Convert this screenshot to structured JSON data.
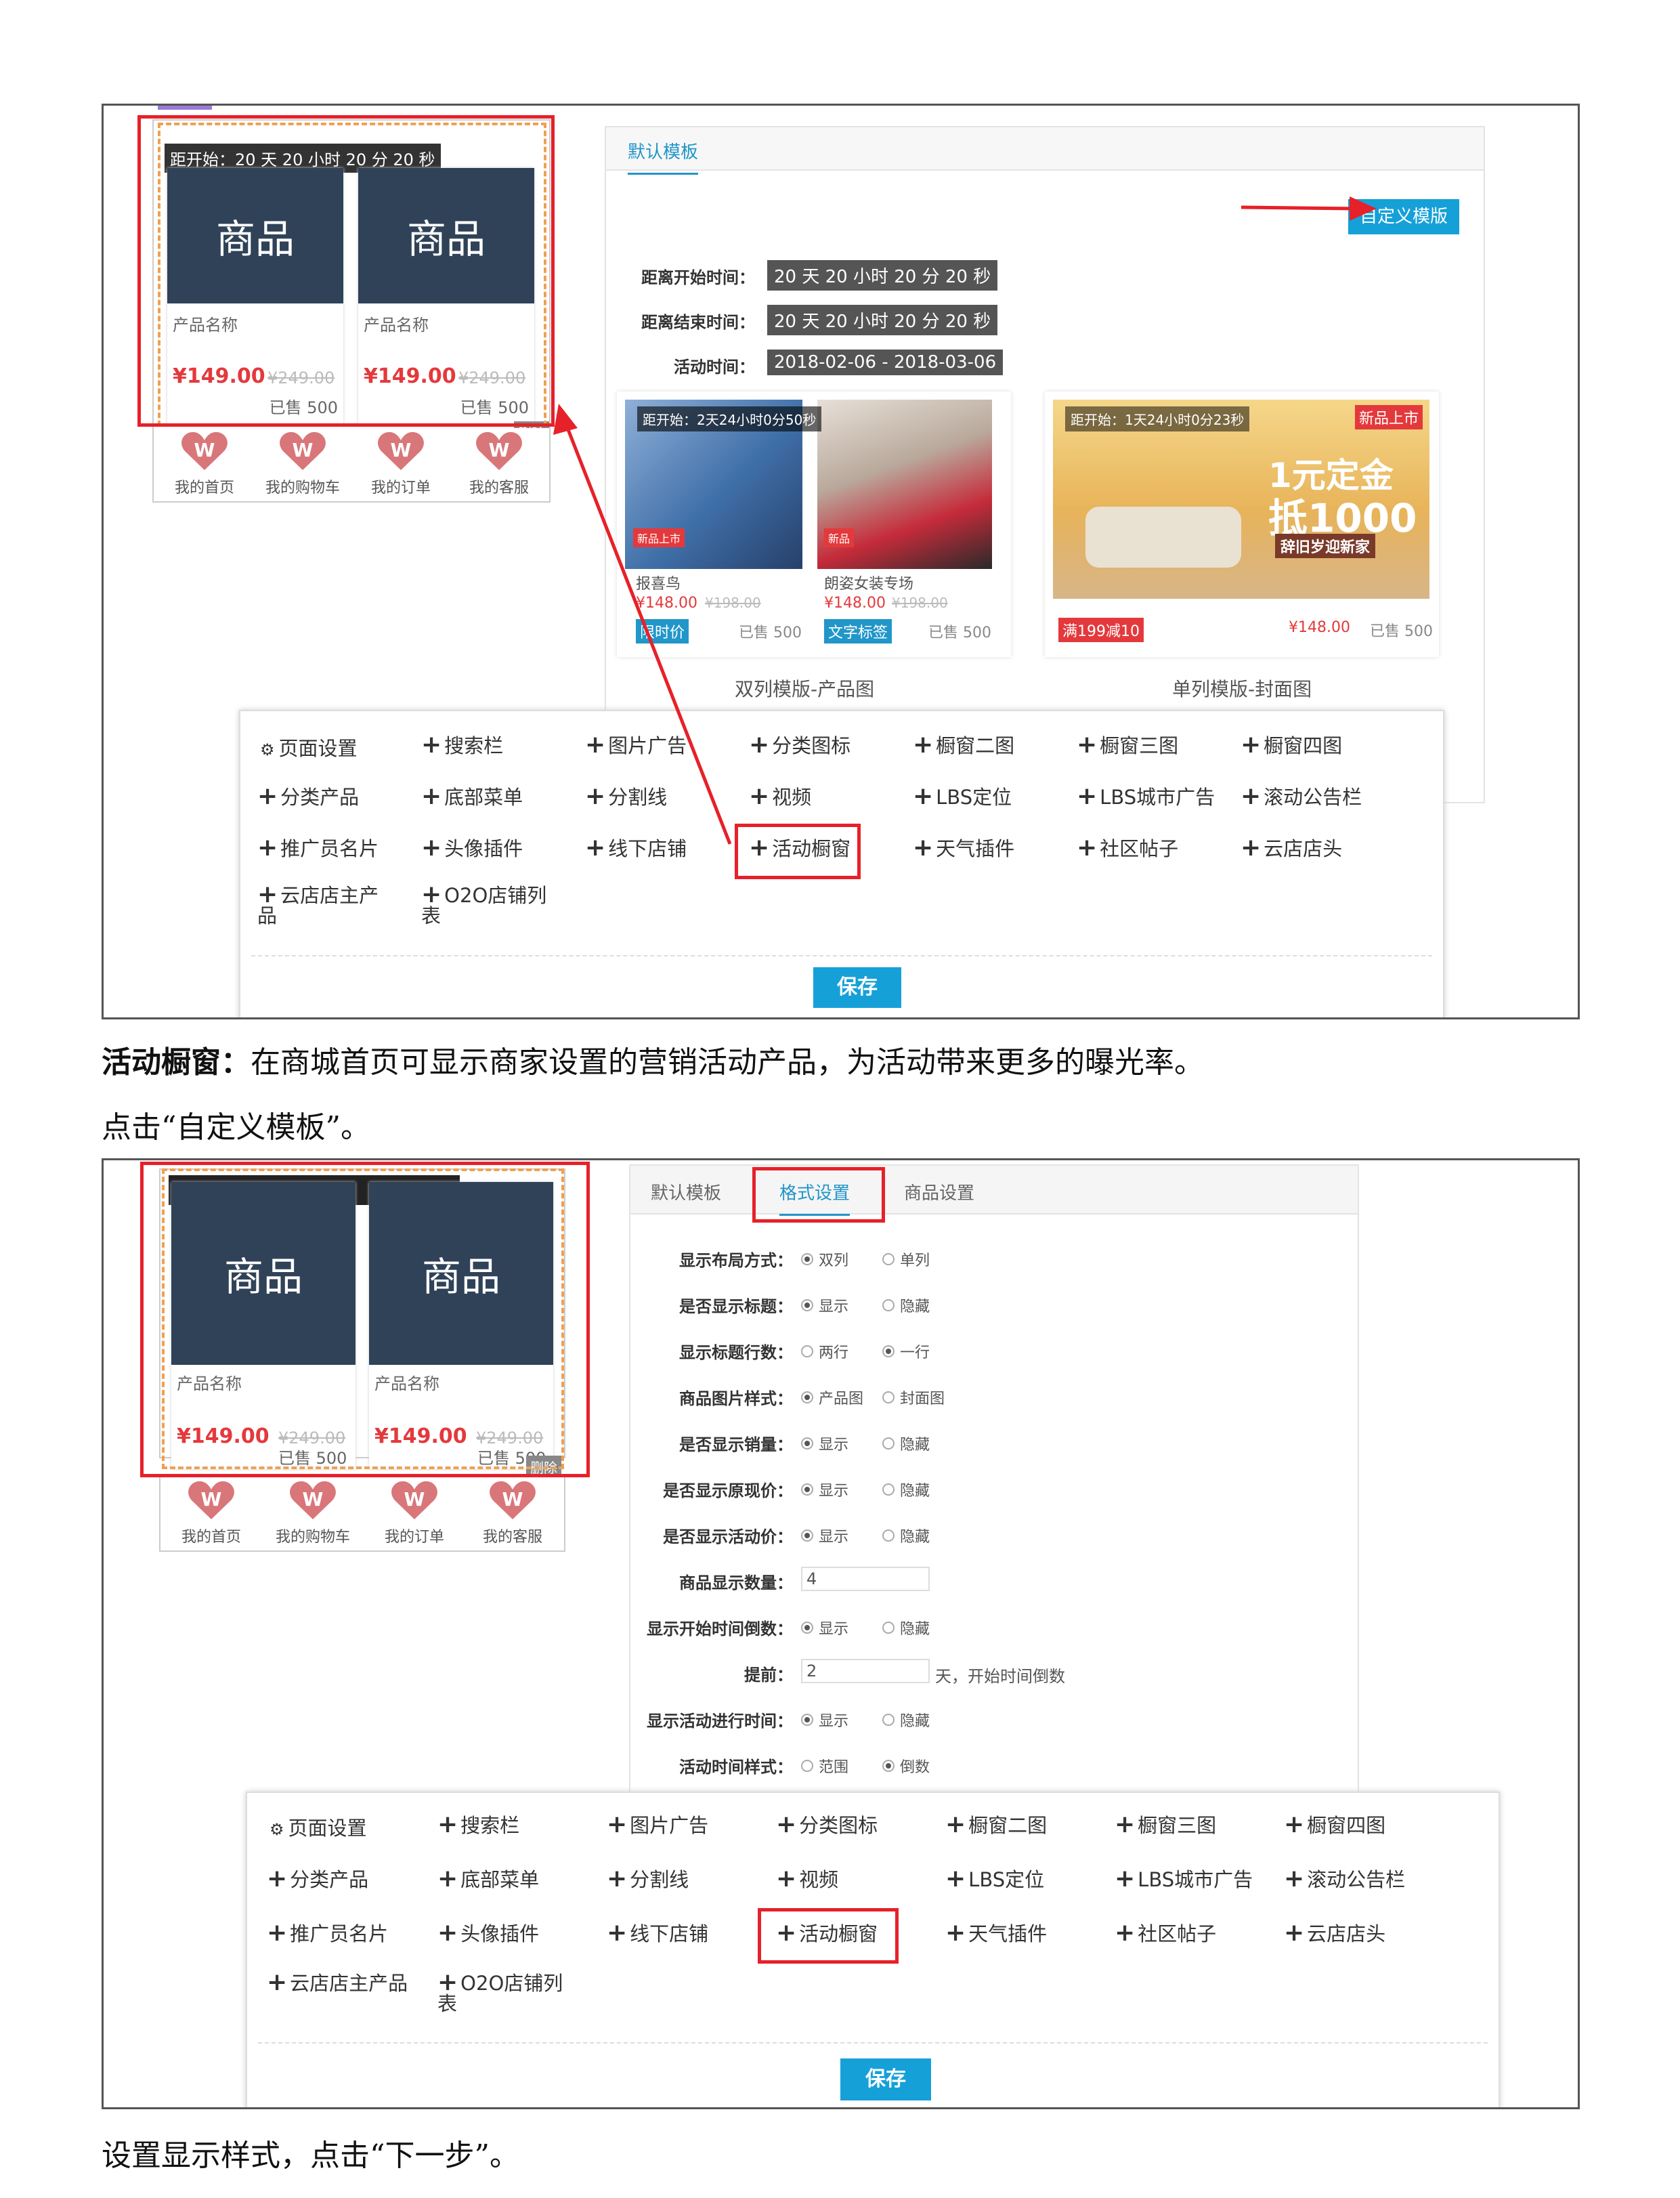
{
  "phone": {
    "countdown": "距开始：20 天 20 小时 20 分 20 秒",
    "products": [
      {
        "img": "商品",
        "name": "产品名称",
        "price": "¥149.00",
        "old_price": "¥249.00",
        "sold": "已售 500"
      },
      {
        "img": "商品",
        "name": "产品名称",
        "price": "¥149.00",
        "old_price": "¥249.00",
        "sold": "已售 500"
      }
    ],
    "delete": "删除",
    "nav": [
      "我的首页",
      "我的购物车",
      "我的订单",
      "我的客服"
    ]
  },
  "panel1": {
    "tab": "默认模板",
    "custom_button": "自定义模版",
    "rows": [
      {
        "label": "距离开始时间：",
        "value": "20 天 20 小时 20 分 20 秒"
      },
      {
        "label": "距离结束时间：",
        "value": "20 天 20 小时 20 分 20 秒"
      },
      {
        "label": "活动时间：",
        "value": "2018-02-06 - 2018-03-06"
      }
    ],
    "double": {
      "countdown": "距开始：2天24小时0分50秒",
      "items": [
        {
          "name": "报喜鸟",
          "price": "¥148.00",
          "old": "¥198.00",
          "tag": "限时价",
          "sold": "已售 500",
          "badge": "新品上市"
        },
        {
          "name": "朗姿女装专场",
          "price": "¥148.00",
          "old": "¥198.00",
          "tag": "文字标签",
          "sold": "已售 500",
          "badge": "新品"
        }
      ],
      "caption": "双列模版-产品图"
    },
    "single": {
      "countdown": "距开始：1天24小时0分23秒",
      "badge": "新品上市",
      "promo_line1": "1元定金",
      "promo_line2": "抵1000",
      "promo_line3": "辞旧岁迎新家",
      "tag": "满199减10",
      "price": "¥148.00",
      "sold": "已售 500",
      "caption": "单列模版-封面图"
    }
  },
  "toolbar": {
    "items": [
      [
        "页面设置",
        "搜索栏",
        "图片广告",
        "分类图标",
        "橱窗二图",
        "橱窗三图",
        "橱窗四图"
      ],
      [
        "分类产品",
        "底部菜单",
        "分割线",
        "视频",
        "LBS定位",
        "LBS城市广告",
        "滚动公告栏"
      ],
      [
        "推广员名片",
        "头像插件",
        "线下店铺",
        "活动橱窗",
        "天气插件",
        "社区帖子",
        "云店店头"
      ],
      [
        "云店店主产品",
        "O2O店铺列表"
      ]
    ],
    "save": "保存"
  },
  "caption1_bold": "活动橱窗：",
  "caption1_rest": "在商城首页可显示商家设置的营销活动产品，为活动带来更多的曝光率。",
  "caption2": "点击“自定义模板”。",
  "panel2": {
    "tabs": [
      "默认模板",
      "格式设置",
      "商品设置"
    ],
    "fields": [
      {
        "label": "显示布局方式：",
        "opts": [
          "双列",
          "单列"
        ],
        "sel": 0
      },
      {
        "label": "是否显示标题：",
        "opts": [
          "显示",
          "隐藏"
        ],
        "sel": 0
      },
      {
        "label": "显示标题行数：",
        "opts": [
          "两行",
          "一行"
        ],
        "sel": 1
      },
      {
        "label": "商品图片样式：",
        "opts": [
          "产品图",
          "封面图"
        ],
        "sel": 0
      },
      {
        "label": "是否显示销量：",
        "opts": [
          "显示",
          "隐藏"
        ],
        "sel": 0
      },
      {
        "label": "是否显示原现价：",
        "opts": [
          "显示",
          "隐藏"
        ],
        "sel": 0
      },
      {
        "label": "是否显示活动价：",
        "opts": [
          "显示",
          "隐藏"
        ],
        "sel": 0
      },
      {
        "label": "商品显示数量：",
        "input": "4"
      },
      {
        "label": "显示开始时间倒数：",
        "opts": [
          "显示",
          "隐藏"
        ],
        "sel": 0
      },
      {
        "label": "提前：",
        "input": "2",
        "suffix": "天，开始时间倒数"
      },
      {
        "label": "显示活动进行时间：",
        "opts": [
          "显示",
          "隐藏"
        ],
        "sel": 0
      },
      {
        "label": "活动时间样式：",
        "opts": [
          "范围",
          "倒数"
        ],
        "sel": 1
      }
    ]
  },
  "caption3": "设置显示样式，点击“下一步”。"
}
